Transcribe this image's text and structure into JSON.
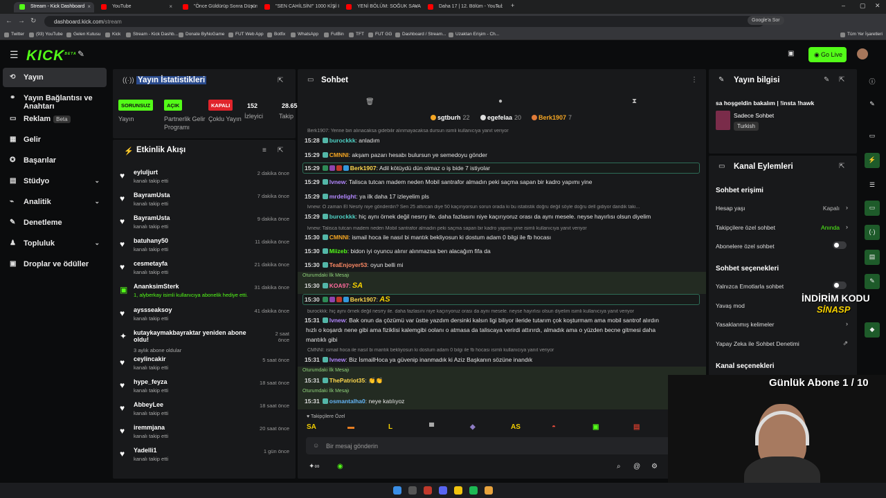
{
  "browser": {
    "tabs": [
      {
        "title": "Stream - Kick Dashboard",
        "active": true,
        "color": "#53fc18"
      },
      {
        "title": "YouTube",
        "active": false,
        "color": "#ff0000"
      },
      {
        "title": "\"Önce Güldürüp Sonra Düşünd",
        "active": false,
        "color": "#ff0000"
      },
      {
        "title": "\"SEN CAHİLSİN!\" 1000 KİŞİ İLE",
        "active": false,
        "color": "#ff0000"
      },
      {
        "title": "YENİ BÖLÜM: SOĞUK SAVAŞ Et",
        "active": false,
        "color": "#ff0000"
      },
      {
        "title": "Daha 17 | 12. Bölüm - YouTube",
        "active": false,
        "color": "#ff0000"
      }
    ],
    "new_tab": "+",
    "url_host": "dashboard.kick.com",
    "url_path": "/stream",
    "google_lens": "Google'a Sor",
    "bookmarks": [
      "Twitter",
      "(93) YouTube",
      "Gelen Kutusu",
      "Kick",
      "Stream - Kick Dashb...",
      "Donate ByNoGame",
      "FUT Web App",
      "Botfix",
      "WhatsApp",
      "FutBin",
      "TFT",
      "FUT GG",
      "Dashboard / Stream...",
      "Uzaktan Erişim - Ch..."
    ],
    "all_bookmarks": "Tüm Yer İşaretleri"
  },
  "topnav": {
    "logo": "KICK",
    "logo_sup": "BETA",
    "go_live": "Go Live"
  },
  "sidebar": {
    "items": [
      {
        "label": "Yayın",
        "icon": "⟲"
      },
      {
        "label": "Yayın Bağlantısı ve Anahtarı",
        "icon": "⚭"
      },
      {
        "label": "Reklam",
        "icon": "▭",
        "badge": "Beta"
      },
      {
        "label": "Gelir",
        "icon": "▦"
      },
      {
        "label": "Başarılar",
        "icon": "✪"
      },
      {
        "label": "Stüdyo",
        "icon": "▤"
      },
      {
        "label": "Analitik",
        "icon": "⌁"
      },
      {
        "label": "Denetleme",
        "icon": "✎"
      },
      {
        "label": "Topluluk",
        "icon": "♟"
      },
      {
        "label": "Droplar ve ödüller",
        "icon": "▣"
      }
    ]
  },
  "stats": {
    "title": "Yayın İstatistikleri",
    "badges": [
      {
        "value": "SORUNSUZ",
        "label": "Yayın",
        "bg": "#53fc18",
        "fg": "#111"
      },
      {
        "value": "AÇIK",
        "label": "Partnerlik Gelir Programı",
        "bg": "#53fc18",
        "fg": "#111"
      },
      {
        "value": "KAPALI",
        "label": "Çoklu Yayın",
        "bg": "#e0242b",
        "fg": "#fff"
      },
      {
        "value": "152",
        "label": "İzleyici",
        "bg": "",
        "fg": "#fff"
      },
      {
        "value": "28.65",
        "label": "Takip",
        "bg": "",
        "fg": "#fff"
      }
    ]
  },
  "feed": {
    "title": "Etkinlik Akışı",
    "items": [
      {
        "name": "eyluljurt",
        "sub": "kanalı takip etti",
        "when": "2 dakika önce"
      },
      {
        "name": "BayramUsta",
        "sub": "kanalı takip etti",
        "when": "7 dakika önce"
      },
      {
        "name": "BayramUsta",
        "sub": "kanalı takip etti",
        "when": "9 dakika önce"
      },
      {
        "name": "batuhany50",
        "sub": "kanalı takip etti",
        "when": "11 dakika önce"
      },
      {
        "name": "cesmetayfa",
        "sub": "kanalı takip etti",
        "when": "21 dakika önce"
      },
      {
        "name": "AnanksimSterk",
        "sub": "1, alyberkay isimli kullanıcıya abonelik hediye etti.",
        "when": "31 dakika önce"
      },
      {
        "name": "ayssseaksoy",
        "sub": "kanalı takip etti",
        "when": "41 dakika önce"
      },
      {
        "name": "kutaykaymakbayraktar yeniden abone oldu!",
        "sub": "3 aylık abone oldular",
        "when": "2 saat önce"
      },
      {
        "name": "ceylincakir",
        "sub": "kanalı takip etti",
        "when": "5 saat önce"
      },
      {
        "name": "hype_feyza",
        "sub": "kanalı takip etti",
        "when": "18 saat önce"
      },
      {
        "name": "AbbeyLee",
        "sub": "kanalı takip etti",
        "when": "18 saat önce"
      },
      {
        "name": "iremmjana",
        "sub": "kanalı takip etti",
        "when": "20 saat önce"
      },
      {
        "name": "Yadelli1",
        "sub": "kanalı takip etti",
        "when": "1 gün önce"
      }
    ]
  },
  "chat": {
    "title": "Sohbet",
    "top_gifters": [
      {
        "name": "sgtburh",
        "count": "22"
      },
      {
        "name": "egefelaa",
        "count": "20"
      },
      {
        "name": "Berk1907",
        "count": "7"
      }
    ],
    "lines": [
      {
        "kind": "reply",
        "text": "Berk1907: Yerine biri alınacaksa gidebilir alınmayacaksa dursun isimli kullanıcıya yanıt veriyor"
      },
      {
        "kind": "msg",
        "time": "15:28",
        "user": "burockkk",
        "color": "#4fd1c5",
        "text": "anladım"
      },
      {
        "kind": "msg",
        "time": "15:29",
        "user": "CMNNI",
        "color": "#f5a623",
        "text": "akşam pazarı hesabı bulursun ye semedoyu gönder"
      },
      {
        "kind": "msg-hl",
        "time": "15:29",
        "user": "Berk1907",
        "color": "#ffd84d",
        "text": "Adil kötüydü dün olmaz o iş bide 7 istiyolar"
      },
      {
        "kind": "msg",
        "time": "15:29",
        "user": "lvnew",
        "color": "#b388ff",
        "text": "Taliscа tutcan madem neden Mobil santrafor almadın peki saçma sapan bir kadro yapımı yine"
      },
      {
        "kind": "msg",
        "time": "15:29",
        "user": "mrdelight",
        "color": "#b388ff",
        "text": "ya ilk daha 17 izleyelim pls"
      },
      {
        "kind": "reply",
        "text": "lvnew: O zaman El Nesrly niye gönderdin? Sen 25 attırcan diye 50 kaçırıyorsun sorun orada ki bu istatistik doğru değil söyle doğru dell gidiyor dandik takı..."
      },
      {
        "kind": "msg",
        "time": "15:29",
        "user": "burockkk",
        "color": "#4fd1c5",
        "text": "hiç aynı örnek değil nesrry ile. daha fazlasını niye kaçırıyoruz orası da aynı mesele. neyse hayırlısı olsun diyelim"
      },
      {
        "kind": "reply",
        "text": "lvnew: Talisca tutcan madem neden Mobil santrafor almadın peki saçma sapan bir kadro yapımı yine isimli kullanıcıya yanıt veriyor"
      },
      {
        "kind": "msg",
        "time": "15:30",
        "user": "CMNNI",
        "color": "#f5a623",
        "text": "ismail hoca ile nasıl bi mantık bekliyosun ki dostum adam 0 bilgi ile fb hocası"
      },
      {
        "kind": "msg",
        "time": "15:30",
        "user": "Miizeb",
        "color": "#53fc18",
        "text": "bidon iyi oyuncu alınır alınmazsa ben alacağım fifa da"
      },
      {
        "kind": "msg",
        "time": "15:30",
        "user": "TeaEnjoyer53",
        "color": "#ff8a65",
        "text": "oyun belli mi"
      },
      {
        "kind": "first-label",
        "text": "Oturumdaki İlk Mesajı"
      },
      {
        "kind": "msg-first",
        "time": "15:30",
        "user": "KOA97",
        "color": "#ff6b9d",
        "text": "SA"
      },
      {
        "kind": "msg-hl",
        "time": "15:30",
        "user": "Berk1907",
        "color": "#ffd84d",
        "text": "AS"
      },
      {
        "kind": "reply",
        "text": "burockkk: hiç aynı örnek değil nesrry ile. daha fazlasını niye kaçırıyoruz orası da aynı mesele. neyse hayırlısı olsun diyelim isimli kullanıcıya yanıt veriyor"
      },
      {
        "kind": "msg",
        "time": "15:31",
        "user": "lvnew",
        "color": "#b388ff",
        "text": "Bak onun da çözümü var üstte yazdım dersinki kalsın ligi biliyor ileride tutarım çok koşturmam ama mobil santrof alırdın"
      },
      {
        "kind": "cont",
        "text": "hızlı o koşardı nene gibi ama fiziklisi kalemgibi oolanı o atmasa da taliscaya verirdi attırırdı, almadık ama o yüzden becne gitmesi daha"
      },
      {
        "kind": "cont",
        "text": "mantıklı gibi"
      },
      {
        "kind": "reply",
        "text": "CMNNI: ismail hoca ile nasıl bi mantık bekliyosun ki dostum adam 0 bilgi ile fb hocası isimli kullanıcıya yanıt veriyor"
      },
      {
        "kind": "msg",
        "time": "15:31",
        "user": "lvnew",
        "color": "#b388ff",
        "text": "Biz İsmailHoca ya güvenip inanmadık ki Aziz Başkanın sözüne inandık"
      },
      {
        "kind": "first-label",
        "text": "Oturumdaki İlk Mesajı"
      },
      {
        "kind": "msg-first",
        "time": "15:31",
        "user": "ThePatriot35",
        "color": "#ffd84d",
        "text": "👏👏"
      },
      {
        "kind": "first-label",
        "text": "Oturumdaki İlk Mesajı"
      },
      {
        "kind": "msg-first",
        "time": "15:31",
        "user": "osmantalha0",
        "color": "#64b5f6",
        "text": "neye katılıyoz"
      }
    ],
    "followers_only": "Takipçilere Özel",
    "emotes": [
      "SA",
      "▬",
      "L",
      "▀",
      "◆",
      "AS",
      "◓",
      "▣",
      "▤"
    ],
    "input_placeholder": "Bir mesaj gönderin"
  },
  "stream_info": {
    "title": "Yayın bilgisi",
    "stream_title": "sa hoşgeldin bakalım | !insta !hawk",
    "category": "Sadece Sohbet",
    "language": "Turkish"
  },
  "channel_actions": {
    "title": "Kanal Eylemleri",
    "chat_access": "Sohbet erişimi",
    "rows_access": [
      {
        "label": "Hesap yaşı",
        "value": "Kapalı",
        "value_color": "#bbbbbb",
        "type": "arrow"
      },
      {
        "label": "Takipçilere özel sohbet",
        "value": "Anında",
        "value_color": "#53fc18",
        "type": "arrow"
      },
      {
        "label": "Abonelere özel sohbet",
        "value": "",
        "value_color": "",
        "type": "toggle"
      }
    ],
    "chat_options": "Sohbet seçenekleri",
    "rows_options": [
      {
        "label": "Yalnızca Emotlarla sohbet",
        "type": "toggle"
      },
      {
        "label": "Yavaş mod",
        "type": "none"
      },
      {
        "label": "Yasaklanmış kelimeler",
        "type": "arrow"
      },
      {
        "label": "Yapay Zeka ile Sohbet Denetimi",
        "type": "external"
      }
    ],
    "channel_options": "Kanal seçenekleri"
  },
  "overlay": {
    "discount": "İNDİRİM KODU",
    "discount_code": "SİNASP",
    "daily_sub": "Günlük Abone 1 / 10"
  }
}
